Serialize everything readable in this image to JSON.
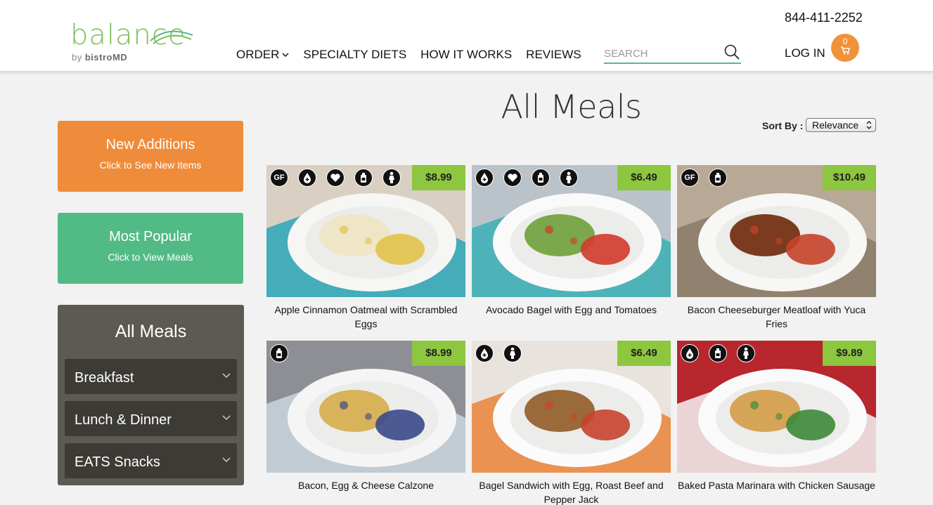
{
  "header": {
    "logo_word": "balance",
    "logo_sub_by": "by",
    "logo_sub_brand": "bistroMD",
    "phone": "844-411-2252",
    "nav": [
      {
        "label": "ORDER"
      },
      {
        "label": "SPECIALTY DIETS"
      },
      {
        "label": "HOW IT WORKS"
      },
      {
        "label": "REVIEWS"
      }
    ],
    "search_placeholder": "SEARCH",
    "login_label": "LOG IN",
    "cart_count": "0"
  },
  "sidebar": {
    "new_additions": {
      "title": "New Additions",
      "subtitle": "Click to See New Items"
    },
    "most_popular": {
      "title": "Most Popular",
      "subtitle": "Click to View Meals"
    },
    "categories_title": "All Meals",
    "categories": [
      {
        "label": "Breakfast"
      },
      {
        "label": "Lunch & Dinner"
      },
      {
        "label": "EATS Snacks"
      }
    ]
  },
  "main": {
    "title": "All Meals",
    "sort_label": "Sort By :",
    "sort_value": "Relevance",
    "meals": [
      {
        "name": "Apple Cinnamon Oatmeal with Scrambled Eggs",
        "price": "$8.99",
        "badges": [
          "gf-icon",
          "diabetic-icon",
          "heart-icon",
          "bottle-icon",
          "female-icon"
        ],
        "badge_text": [
          "GF",
          "",
          "",
          "",
          ""
        ]
      },
      {
        "name": "Avocado Bagel with Egg and Tomatoes",
        "price": "$6.49",
        "badges": [
          "diabetic-icon",
          "heart-icon",
          "bottle-icon",
          "female-icon"
        ],
        "badge_text": [
          "",
          "",
          "",
          ""
        ]
      },
      {
        "name": "Bacon Cheeseburger Meatloaf with Yuca Fries",
        "price": "$10.49",
        "badges": [
          "gf-icon",
          "bottle-icon"
        ],
        "badge_text": [
          "GF",
          ""
        ]
      },
      {
        "name": "Bacon, Egg & Cheese Calzone",
        "price": "$8.99",
        "badges": [
          "bottle-icon"
        ],
        "badge_text": [
          ""
        ]
      },
      {
        "name": "Bagel Sandwich with Egg, Roast Beef and Pepper Jack",
        "price": "$6.49",
        "badges": [
          "diabetic-icon",
          "female-icon"
        ],
        "badge_text": [
          "",
          ""
        ]
      },
      {
        "name": "Baked Pasta Marinara with Chicken Sausage",
        "price": "$9.89",
        "badges": [
          "diabetic-icon",
          "bottle-icon",
          "female-icon"
        ],
        "badge_text": [
          "",
          "",
          ""
        ]
      }
    ]
  },
  "colors": {
    "brand_green": "#7dbf57",
    "orange": "#ef8c3b",
    "teal_green": "#52bb85",
    "price_green": "#8dc63f",
    "panel_dark": "#5c5a52"
  }
}
